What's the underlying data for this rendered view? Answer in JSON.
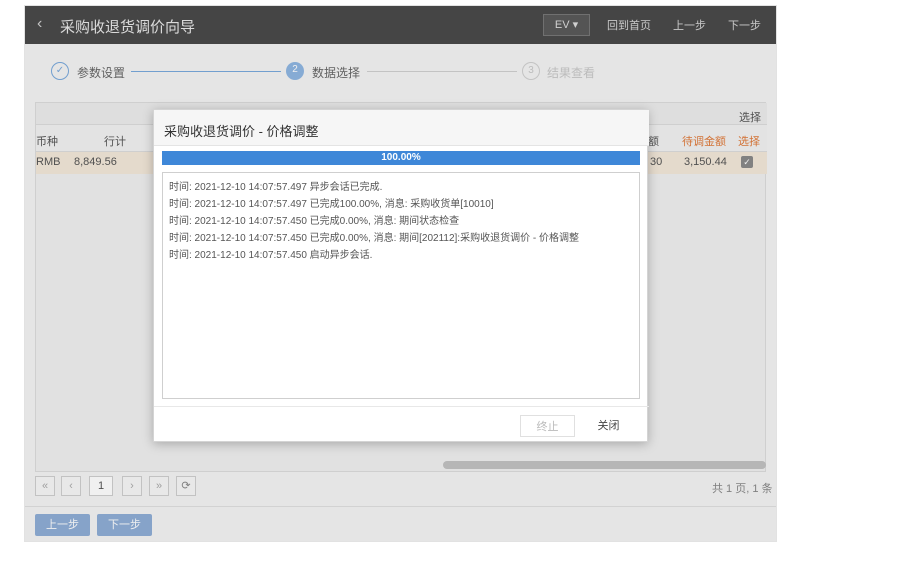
{
  "header": {
    "back_icon": "chevron-left-icon",
    "title": "采购收退货调价向导",
    "ev_label": "EV",
    "home_label": "回到首页",
    "prev_label": "上一步",
    "next_label": "下一步"
  },
  "steps": [
    {
      "index": "✓",
      "label": "参数设置",
      "state": "done"
    },
    {
      "index": "2",
      "label": "数据选择",
      "state": "active"
    },
    {
      "index": "3",
      "label": "结果查看",
      "state": "pending"
    }
  ],
  "table": {
    "group_header": "选择",
    "headers": {
      "currency": "币种",
      "row_total": "行计",
      "amount_label": "额",
      "pending_amount": "待调金额",
      "select": "选择"
    },
    "row": {
      "currency": "RMB",
      "row_total": "8,849.56",
      "amount_partial": "30",
      "pending_amount": "3,150.44",
      "checked": true
    }
  },
  "pager": {
    "first": "«",
    "prev": "‹",
    "page": "1",
    "next": "›",
    "last": "»",
    "refresh_icon": "refresh-icon",
    "info": "共 1 页, 1 条"
  },
  "footer": {
    "prev_label": "上一步",
    "next_label": "下一步"
  },
  "modal": {
    "title": "采购收退货调价 - 价格调整",
    "progress_percent": 100,
    "progress_label": "100.00%",
    "log": [
      "时间: 2021-12-10 14:07:57.497 异步会话已完成.",
      "时间: 2021-12-10 14:07:57.497 已完成100.00%, 消息: 采购收货单[10010]",
      "时间: 2021-12-10 14:07:57.450 已完成0.00%, 消息: 期间状态检查",
      "时间: 2021-12-10 14:07:57.450 已完成0.00%, 消息: 期间[202112]:采购收退货调价 - 价格调整",
      "时间: 2021-12-10 14:07:57.450 启动异步会话."
    ],
    "stop_label": "终止",
    "close_label": "关闭"
  },
  "colors": {
    "header_bg": "#4a4a4a",
    "accent": "#3e87d8",
    "step_done": "#6aa0d8",
    "pending_amount": "#e07a3a",
    "row_highlight": "#f3e8d9"
  }
}
